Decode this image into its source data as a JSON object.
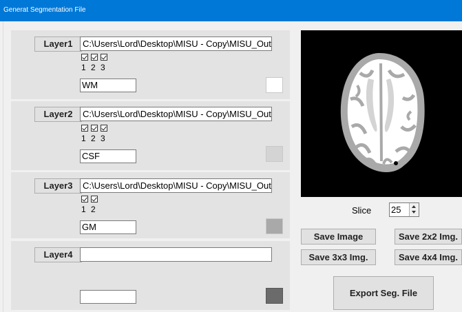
{
  "window": {
    "title": "Generat Segmentation File"
  },
  "layers": [
    {
      "button": "Layer1",
      "path": "C:\\Users\\Lord\\Desktop\\MISU - Copy\\MISU_Outp",
      "checks": [
        "1",
        "2",
        "3"
      ],
      "name": "WM",
      "color": "#ffffff"
    },
    {
      "button": "Layer2",
      "path": "C:\\Users\\Lord\\Desktop\\MISU - Copy\\MISU_Outp",
      "checks": [
        "1",
        "2",
        "3"
      ],
      "name": "CSF",
      "color": "#d4d4d4"
    },
    {
      "button": "Layer3",
      "path": "C:\\Users\\Lord\\Desktop\\MISU - Copy\\MISU_Outp",
      "checks": [
        "1",
        "2"
      ],
      "name": "GM",
      "color": "#a9a9a9"
    },
    {
      "button": "Layer4",
      "path": "",
      "checks": [],
      "name": "",
      "color": "#6b6b6b"
    }
  ],
  "slice": {
    "label": "Slice",
    "value": "25"
  },
  "buttons": {
    "save_image": "Save Image",
    "save_2x2": "Save 2x2 Img.",
    "save_3x3": "Save 3x3 Img.",
    "save_4x4": "Save 4x4 Img.",
    "export": "Export Seg. File"
  },
  "colors": {
    "titlebar": "#0078d7",
    "panel": "#e3e3e3",
    "wm": "#ffffff",
    "gm": "#a9a9a9",
    "csf": "#d4d4d4"
  },
  "icons": [
    "checkbox-icon",
    "spin-up-icon",
    "spin-down-icon"
  ]
}
